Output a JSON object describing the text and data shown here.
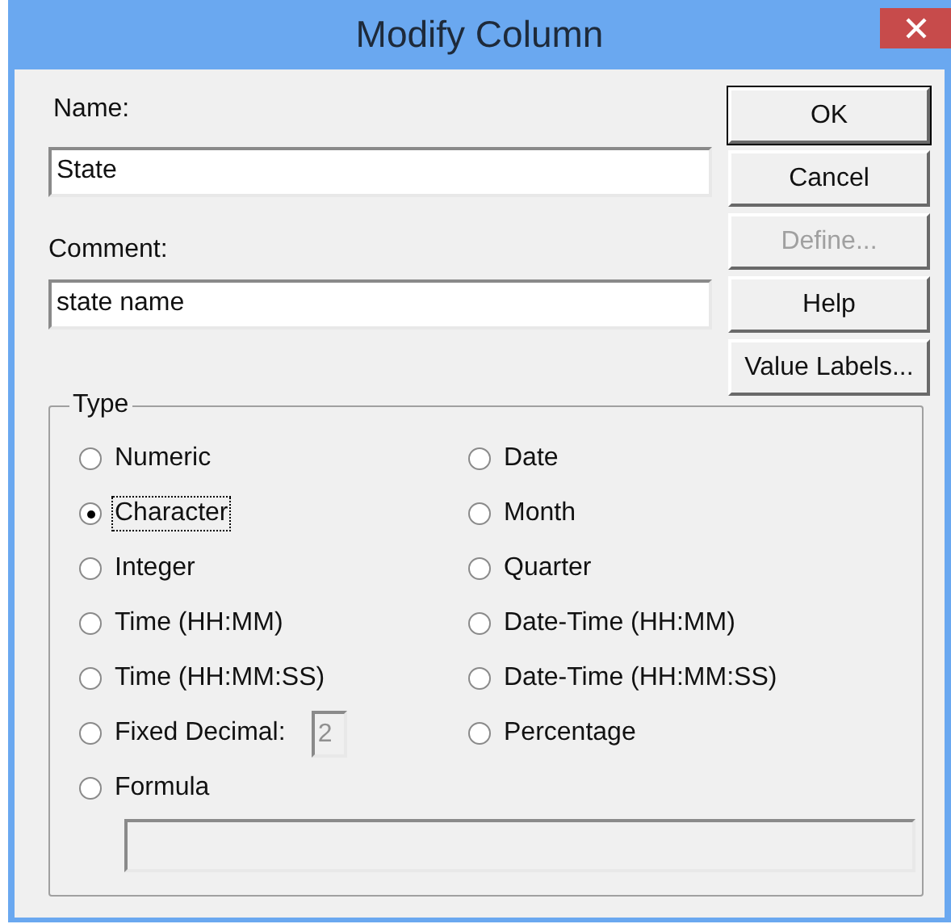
{
  "window": {
    "title": "Modify Column"
  },
  "name_field": {
    "label": "Name:",
    "value": "State"
  },
  "comment_field": {
    "label": "Comment:",
    "value": "state name"
  },
  "buttons": [
    {
      "label": "OK",
      "disabled": false,
      "default": true
    },
    {
      "label": "Cancel",
      "disabled": false,
      "default": false
    },
    {
      "label": "Define...",
      "disabled": true,
      "default": false
    },
    {
      "label": "Help",
      "disabled": false,
      "default": false
    },
    {
      "label": "Value Labels...",
      "disabled": false,
      "default": false
    }
  ],
  "type_group": {
    "title": "Type",
    "columns": [
      [
        {
          "label": "Numeric",
          "selected": false,
          "focused": false
        },
        {
          "label": "Character",
          "selected": true,
          "focused": true
        },
        {
          "label": "Integer",
          "selected": false,
          "focused": false
        },
        {
          "label": "Time (HH:MM)",
          "selected": false,
          "focused": false
        },
        {
          "label": "Time (HH:MM:SS)",
          "selected": false,
          "focused": false
        },
        {
          "label": "Fixed Decimal:",
          "selected": false,
          "focused": false,
          "decimals": {
            "value": "2",
            "disabled": true
          }
        },
        {
          "label": "Formula",
          "selected": false,
          "focused": false
        }
      ],
      [
        {
          "label": "Date",
          "selected": false,
          "focused": false
        },
        {
          "label": "Month",
          "selected": false,
          "focused": false
        },
        {
          "label": "Quarter",
          "selected": false,
          "focused": false
        },
        {
          "label": "Date-Time (HH:MM)",
          "selected": false,
          "focused": false
        },
        {
          "label": "Date-Time (HH:MM:SS)",
          "selected": false,
          "focused": false
        },
        {
          "label": "Percentage",
          "selected": false,
          "focused": false
        }
      ]
    ],
    "formula_field": {
      "disabled": true
    }
  }
}
